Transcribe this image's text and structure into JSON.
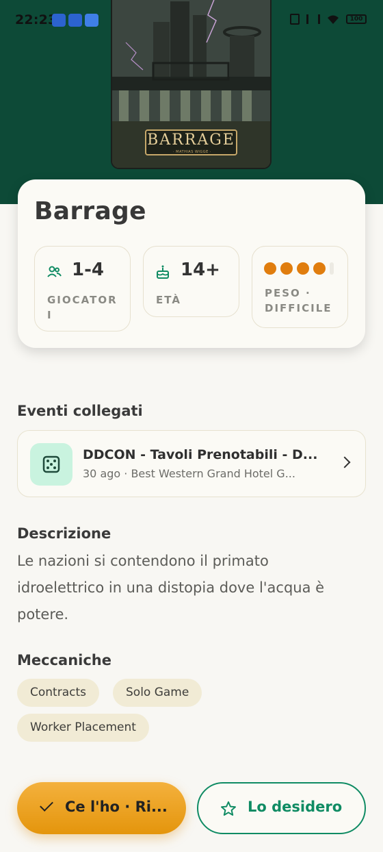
{
  "status_bar": {
    "time": "22:23",
    "battery": "100"
  },
  "cover": {
    "title": "BARRAGE",
    "subtitle": "· MATHIAS WIGGE ·"
  },
  "game": {
    "title": "Barrage",
    "players": {
      "value": "1-4",
      "label": "GIOCATORI"
    },
    "age": {
      "value": "14+",
      "label": "ETÀ"
    },
    "weight": {
      "label": "PESO · DIFFICILE",
      "level_filled": 4,
      "level_max": 5
    }
  },
  "events": {
    "heading": "Eventi collegati",
    "items": [
      {
        "title": "DDCON - Tavoli Prenotabili - D...",
        "subtitle": "30 ago · Best Western Grand Hotel G..."
      }
    ]
  },
  "description": {
    "heading": "Descrizione",
    "text": "Le nazioni si contendono il primato idroelettrico in una distopia dove l'acqua è potere."
  },
  "mechanics": {
    "heading": "Meccaniche",
    "chips": [
      "Contracts",
      "Solo Game",
      "Worker Placement"
    ]
  },
  "actions": {
    "owned_label": "Ce l'ho · Ri...",
    "wish_label": "Lo desidero"
  },
  "colors": {
    "hero_bg": "#0d4a37",
    "accent_green": "#0f8b63",
    "accent_orange": "#e07d0e"
  },
  "icons": [
    "players-icon",
    "cake-icon",
    "dice-icon",
    "chevron-right-icon",
    "check-icon",
    "star-icon"
  ]
}
